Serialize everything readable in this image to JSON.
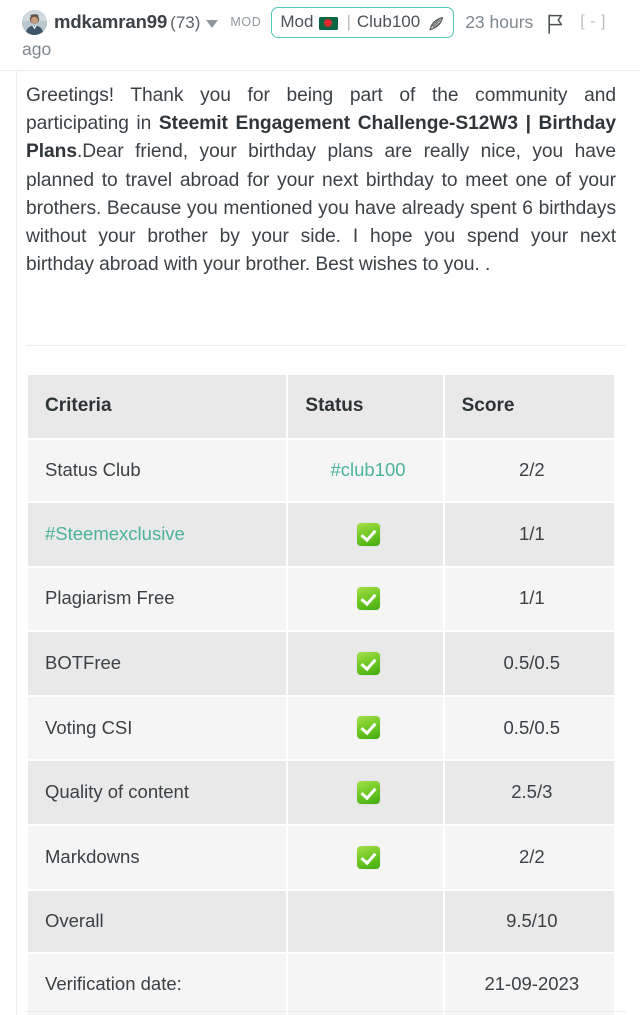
{
  "comment": {
    "author": {
      "username": "mdkamran99",
      "reputation": "(73)",
      "avatar_icon": "user-avatar-photo"
    },
    "mod_tag": "MOD",
    "badge": {
      "mod_label": "Mod",
      "flag_icon": "bangladesh-flag-emoji",
      "separator": "|",
      "club_label": "Club100",
      "quill_icon": "quill-pen-emoji",
      "border_color": "#53c9b6"
    },
    "timestamp": "23 hours",
    "timestamp_suffix": "ago",
    "flag_icon": "flag-report-icon",
    "collapse_label": "[ - ]",
    "caret_icon": "chevron-down-icon"
  },
  "body": {
    "part1": "Greetings! Thank you for being part of the community and participating in ",
    "bold": "Steemit Engagement Challenge-S12W3 | Birthday Plans",
    "part2": ".Dear friend, your birthday plans are really nice, you have planned to travel abroad for your next birthday to meet one of your brothers. Because you mentioned you have already spent 6 birthdays without your brother by your side. I hope you spend your next birthday abroad with your brother. Best wishes to you. ."
  },
  "table": {
    "headers": [
      "Criteria",
      "Status",
      "Score"
    ],
    "rows": [
      {
        "criteria": "Status Club",
        "criteria_link": false,
        "status": "#club100",
        "status_type": "link",
        "score": "2/2"
      },
      {
        "criteria": "#Steemexclusive",
        "criteria_link": true,
        "status": "check",
        "status_type": "check",
        "score": "1/1"
      },
      {
        "criteria": "Plagiarism Free",
        "criteria_link": false,
        "status": "check",
        "status_type": "check",
        "score": "1/1"
      },
      {
        "criteria": "BOTFree",
        "criteria_link": false,
        "status": "check",
        "status_type": "check",
        "score": "0.5/0.5"
      },
      {
        "criteria": "Voting CSI",
        "criteria_link": false,
        "status": "check",
        "status_type": "check",
        "score": "0.5/0.5"
      },
      {
        "criteria": "Quality of content",
        "criteria_link": false,
        "status": "check",
        "status_type": "check",
        "score": "2.5/3"
      },
      {
        "criteria": "Markdowns",
        "criteria_link": false,
        "status": "check",
        "status_type": "check",
        "score": "2/2"
      },
      {
        "criteria": "Overall",
        "criteria_link": false,
        "status": "",
        "status_type": "empty",
        "score": "9.5/10"
      },
      {
        "criteria": "Verification date:",
        "criteria_link": false,
        "status": "",
        "status_type": "empty",
        "score": "21-09-2023"
      }
    ]
  },
  "colors": {
    "teal_link": "#4ab39a",
    "badge_border": "#53c9b6",
    "row_light": "#f5f5f5",
    "row_dark": "#e9e9e9",
    "check_green": "#78cc28"
  }
}
